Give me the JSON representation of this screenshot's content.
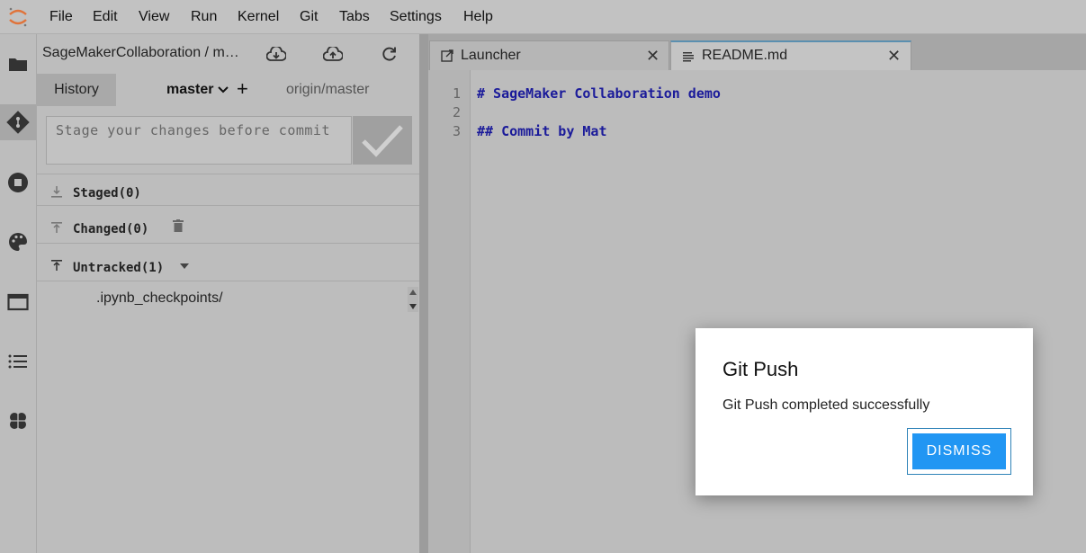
{
  "menubar": {
    "items": [
      "File",
      "Edit",
      "View",
      "Run",
      "Kernel",
      "Git",
      "Tabs",
      "Settings",
      "Help"
    ]
  },
  "activity": {
    "icons": [
      "folder-icon",
      "git-icon",
      "stop-circle-icon",
      "palette-icon",
      "tab-window-icon",
      "list-icon",
      "brain-icon"
    ]
  },
  "git": {
    "repo_title": "SageMakerCollaboration / m…",
    "history_label": "History",
    "branch": "master",
    "plus": "+",
    "remote": "origin/master",
    "commit_placeholder": "Stage your changes before commit",
    "sections": {
      "staged": "Staged(0)",
      "changed": "Changed(0)",
      "untracked": "Untracked(1)"
    },
    "untracked_files": [
      ".ipynb_checkpoints/"
    ]
  },
  "tabs": [
    {
      "label": "Launcher",
      "close": "✕"
    },
    {
      "label": "README.md",
      "close": "✕"
    }
  ],
  "editor": {
    "lines": [
      {
        "num": "1",
        "text": "# SageMaker Collaboration demo"
      },
      {
        "num": "2",
        "text": ""
      },
      {
        "num": "3",
        "text": "## Commit by Mat"
      }
    ]
  },
  "dialog": {
    "title": "Git Push",
    "body": "Git Push completed successfully",
    "button": "DISMISS"
  },
  "colors": {
    "accent": "#2196f3",
    "code": "#1b1b9a",
    "tab_active_border": "#5b8fb0"
  }
}
